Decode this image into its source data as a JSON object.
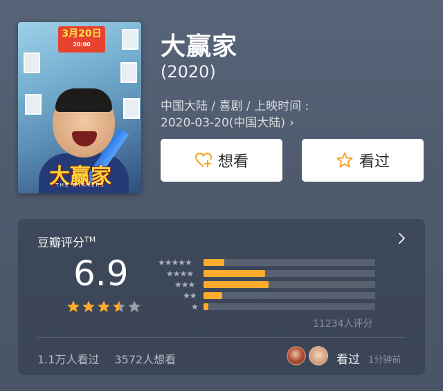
{
  "movie": {
    "title": "大赢家",
    "year": "(2020)",
    "meta_line1": "中国大陆 / 喜剧 / 上映时间 :",
    "meta_line2": "2020-03-20(中国大陆)",
    "meta_chevron": "›"
  },
  "poster": {
    "date_badge": "3月20日",
    "date_badge_time": "20:00",
    "poster_title": "大赢家",
    "poster_subtitle": "THE WINNERS"
  },
  "actions": {
    "want_label": "想看",
    "seen_label": "看过",
    "want_icon": "heart-plus-icon",
    "seen_icon": "star-outline-icon"
  },
  "rating": {
    "label": "豆瓣评分",
    "trademark": "TM",
    "score": "6.9",
    "stars_value": 3.5,
    "stars_max": 5,
    "distribution": [
      {
        "stars": 5,
        "fraction": 0.12
      },
      {
        "stars": 4,
        "fraction": 0.36
      },
      {
        "stars": 3,
        "fraction": 0.38
      },
      {
        "stars": 2,
        "fraction": 0.11
      },
      {
        "stars": 1,
        "fraction": 0.03
      }
    ],
    "count_text": "11234人评分"
  },
  "stats": {
    "seen_text": "1.1万人看过",
    "want_text": "3572人想看"
  },
  "activity": {
    "label": "看过",
    "time": "1分钟前"
  },
  "colors": {
    "bar_fill": "#ffac2d",
    "star_fill": "#ffac2d",
    "star_empty": "#9aa1ab",
    "button_icon": "#f4a62a"
  }
}
